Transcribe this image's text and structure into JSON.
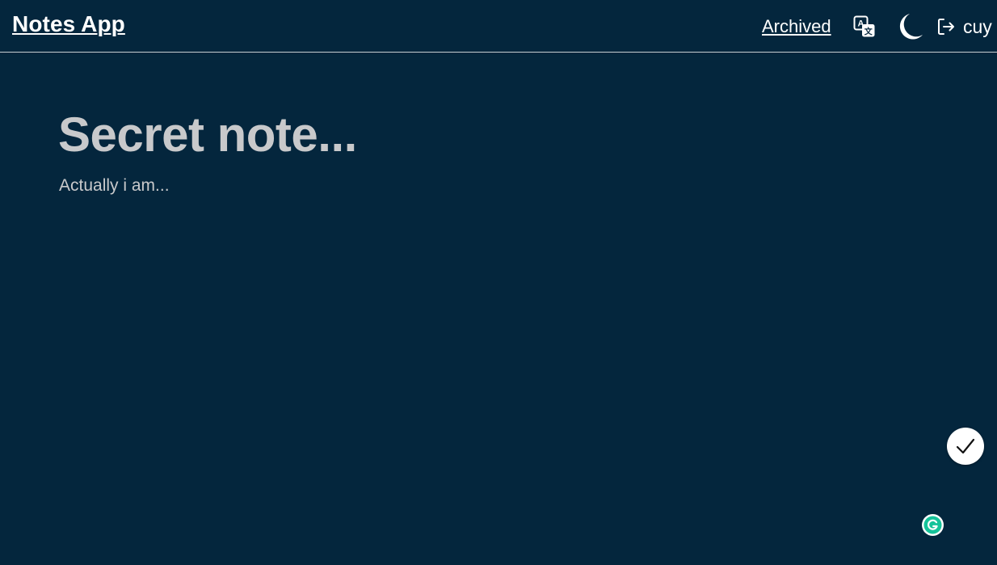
{
  "header": {
    "brand": "Notes App",
    "nav": {
      "archived_label": "Archived"
    },
    "icons": {
      "translate": "translate-icon",
      "theme": "moon-icon",
      "logout": "logout-icon"
    },
    "user": {
      "name": "cuy"
    }
  },
  "note": {
    "title": "Secret note...",
    "body": "Actually i am..."
  },
  "actions": {
    "fab_icon": "check-icon",
    "grammarly_icon": "grammarly-icon"
  },
  "colors": {
    "background": "#04263d",
    "header_text": "#ffffff",
    "note_text": "#c8c9cb",
    "fab_background": "#ffffff",
    "grammarly_green": "#15c39a"
  }
}
